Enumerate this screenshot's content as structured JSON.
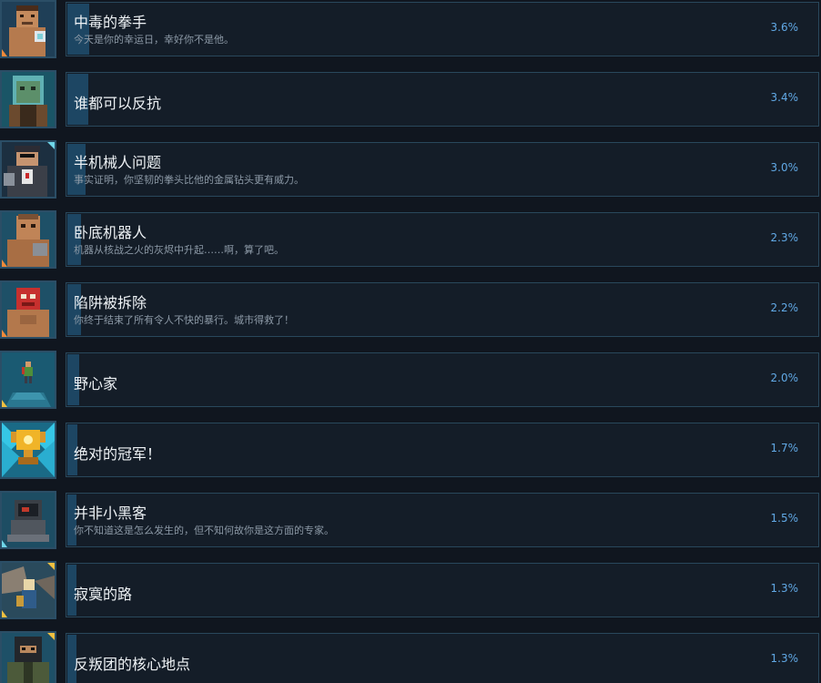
{
  "colors": {
    "background": "#10161f",
    "card": "#141d28",
    "card_border": "#29485c",
    "progress_fill": "#1d4663",
    "title": "#eef2f5",
    "description": "#8c99a6",
    "percent": "#61a9e6"
  },
  "achievements": [
    {
      "title": "中毒的拳手",
      "description": "今天是你的幸运日，幸好你不是他。",
      "percent": "3.6%",
      "fill": 0.036,
      "icon": "poisoned-boxer-icon"
    },
    {
      "title": "谁都可以反抗",
      "description": "",
      "percent": "3.4%",
      "fill": 0.034,
      "icon": "jar-head-zombie-icon"
    },
    {
      "title": "半机械人问题",
      "description": "事实证明，你坚韧的拳头比他的金属钻头更有威力。",
      "percent": "3.0%",
      "fill": 0.03,
      "icon": "cyborg-icon"
    },
    {
      "title": "卧底机器人",
      "description": "机器从核战之火的灰烬中升起……啊，算了吧。",
      "percent": "2.3%",
      "fill": 0.023,
      "icon": "undercover-robot-icon"
    },
    {
      "title": "陷阱被拆除",
      "description": "你终于结束了所有令人不快的暴行。城市得救了！",
      "percent": "2.2%",
      "fill": 0.022,
      "icon": "masked-wrestler-icon"
    },
    {
      "title": "野心家",
      "description": "",
      "percent": "2.0%",
      "fill": 0.02,
      "icon": "tiny-figure-platform-icon"
    },
    {
      "title": "绝对的冠军！",
      "description": "",
      "percent": "1.7%",
      "fill": 0.017,
      "icon": "golden-trophy-icon"
    },
    {
      "title": "并非小黑客",
      "description": "你不知道这是怎么发生的，但不知何故你是这方面的专家。",
      "percent": "1.5%",
      "fill": 0.015,
      "icon": "computer-terminal-icon"
    },
    {
      "title": "寂寞的路",
      "description": "",
      "percent": "1.3%",
      "fill": 0.013,
      "icon": "lonely-road-wanderer-icon"
    },
    {
      "title": "反叛团的核心地点",
      "description": "",
      "percent": "1.3%",
      "fill": 0.013,
      "icon": "hooded-rebel-icon"
    }
  ]
}
